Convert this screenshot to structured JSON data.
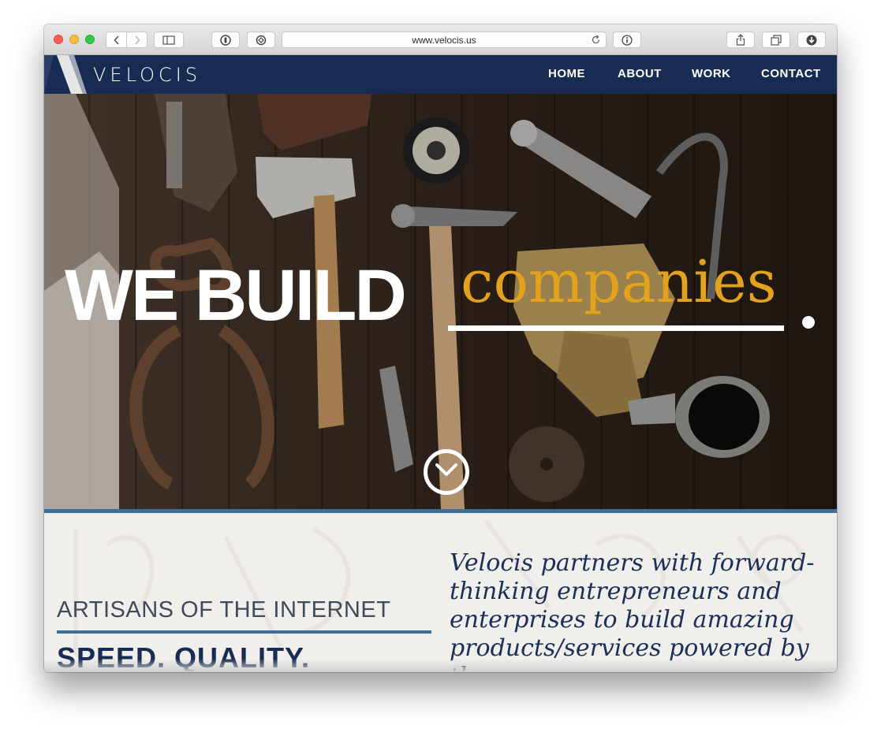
{
  "browser": {
    "url": "www.velocis.us"
  },
  "site": {
    "logo": "VELOCIS",
    "nav": [
      {
        "label": "HOME",
        "active": true
      },
      {
        "label": "ABOUT",
        "active": false
      },
      {
        "label": "WORK",
        "active": false
      },
      {
        "label": "CONTACT",
        "active": false
      }
    ]
  },
  "hero": {
    "title": "WE BUILD",
    "highlight_word": "companies",
    "accent_color": "#e3a21c"
  },
  "intro": {
    "heading": "ARTISANS OF THE INTERNET",
    "subheading": "SPEED. QUALITY.",
    "body": "Velocis partners with forward-thinking entrepreneurs and enterprises to build amazing products/services powered by the"
  },
  "colors": {
    "navy": "#172b53",
    "steel_blue": "#3e6d96",
    "gold": "#e0a424"
  }
}
